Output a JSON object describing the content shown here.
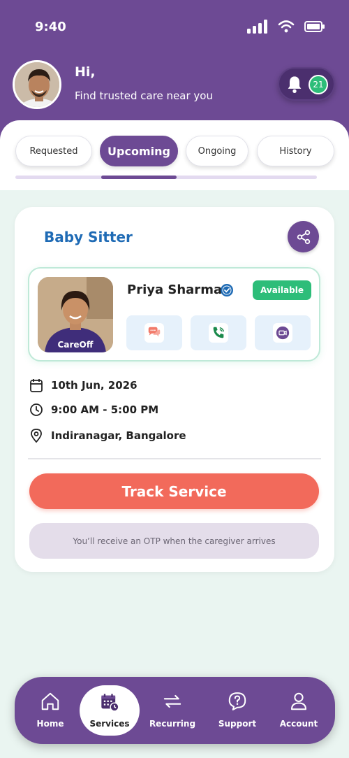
{
  "status": {
    "time": "9:40"
  },
  "header": {
    "greeting": "Hi,",
    "subtitle": "Find trusted care near you",
    "notification_count": "21"
  },
  "tabs": [
    {
      "label": "Requested"
    },
    {
      "label": "Upcoming",
      "active": true
    },
    {
      "label": "Ongoing"
    },
    {
      "label": "History"
    }
  ],
  "booking": {
    "service": "Baby Sitter",
    "caregiver": {
      "name": "Priya Sharma",
      "availability": "Available",
      "shirt_text": "CareOff"
    },
    "date": "10th Jun, 2026",
    "time": "9:00 AM - 5:00 PM",
    "location": "Indiranagar, Bangalore",
    "track_label": "Track Service",
    "otp_note": "You’ll receive an OTP when the caregiver arrives"
  },
  "nav": [
    {
      "label": "Home",
      "icon": "home-icon"
    },
    {
      "label": "Services",
      "icon": "calendar-clock-icon",
      "active": true
    },
    {
      "label": "Recurring",
      "icon": "repeat-icon"
    },
    {
      "label": "Support",
      "icon": "help-chat-icon"
    },
    {
      "label": "Account",
      "icon": "user-icon"
    }
  ],
  "colors": {
    "primary": "#6d4a94",
    "accent_coral": "#f26a5b",
    "success": "#2dbd79",
    "title_blue": "#1f6bb5"
  }
}
